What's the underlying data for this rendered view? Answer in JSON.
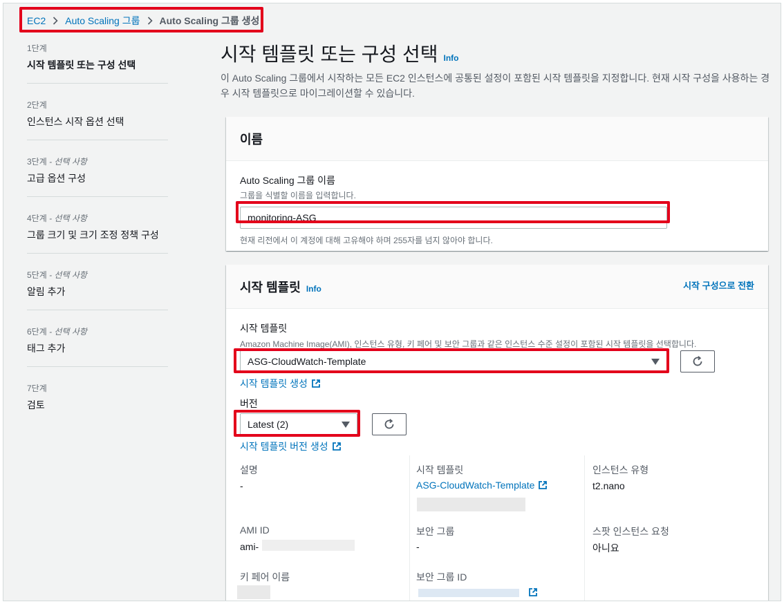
{
  "breadcrumb": {
    "items": [
      "EC2",
      "Auto Scaling 그룹"
    ],
    "current": "Auto Scaling 그룹 생성"
  },
  "sidebar": {
    "steps": [
      {
        "num": "1단계",
        "optional": "",
        "label": "시작 템플릿 또는 구성 선택"
      },
      {
        "num": "2단계",
        "optional": "",
        "label": "인스턴스 시작 옵션 선택"
      },
      {
        "num": "3단계",
        "optional": " - 선택 사항",
        "label": "고급 옵션 구성"
      },
      {
        "num": "4단계",
        "optional": " - 선택 사항",
        "label": "그룹 크기 및 크기 조정 정책 구성"
      },
      {
        "num": "5단계",
        "optional": " - 선택 사항",
        "label": "알림 추가"
      },
      {
        "num": "6단계",
        "optional": " - 선택 사항",
        "label": "태그 추가"
      },
      {
        "num": "7단계",
        "optional": "",
        "label": "검토"
      }
    ]
  },
  "page": {
    "title": "시작 템플릿 또는 구성 선택",
    "info": "Info",
    "description": "이 Auto Scaling 그룹에서 시작하는 모든 EC2 인스턴스에 공통된 설정이 포함된 시작 템플릿을 지정합니다. 현재 시작 구성을 사용하는 경우 시작 템플릿으로 마이그레이션할 수 있습니다."
  },
  "name_card": {
    "header": "이름",
    "label": "Auto Scaling 그룹 이름",
    "description": "그룹을 식별할 이름을 입력합니다.",
    "value": "monitoring-ASG",
    "constraint": "현재 리전에서 이 계정에 대해 고유해야 하며 255자를 넘지 않아야 합니다."
  },
  "template_card": {
    "header": "시작 템플릿",
    "info": "Info",
    "switch_link": "시작 구성으로 전환",
    "template_label": "시작 템플릿",
    "template_desc": "Amazon Machine Image(AMI), 인스턴스 유형, 키 페어 및 보안 그룹과 같은 인스턴스 수준 설정이 포함된 시작 템플릿을 선택합니다.",
    "template_value": "ASG-CloudWatch-Template",
    "create_template_link": "시작 템플릿 생성",
    "version_label": "버전",
    "version_value": "Latest (2)",
    "create_version_link": "시작 템플릿 버전 생성",
    "details": {
      "description_label": "설명",
      "description_value": "-",
      "template_label": "시작 템플릿",
      "template_value": "ASG-CloudWatch-Template",
      "instance_type_label": "인스턴스 유형",
      "instance_type_value": "t2.nano",
      "ami_label": "AMI ID",
      "ami_value": "ami-",
      "security_group_label": "보안 그룹",
      "security_group_value": "-",
      "spot_label": "스팟 인스턴스 요청",
      "spot_value": "아니요",
      "key_pair_label": "키 페어 이름",
      "security_group_id_label": "보안 그룹 ID"
    }
  },
  "colors": {
    "link": "#0073bb",
    "highlight": "#e3001b",
    "background": "#f2f3f3"
  }
}
